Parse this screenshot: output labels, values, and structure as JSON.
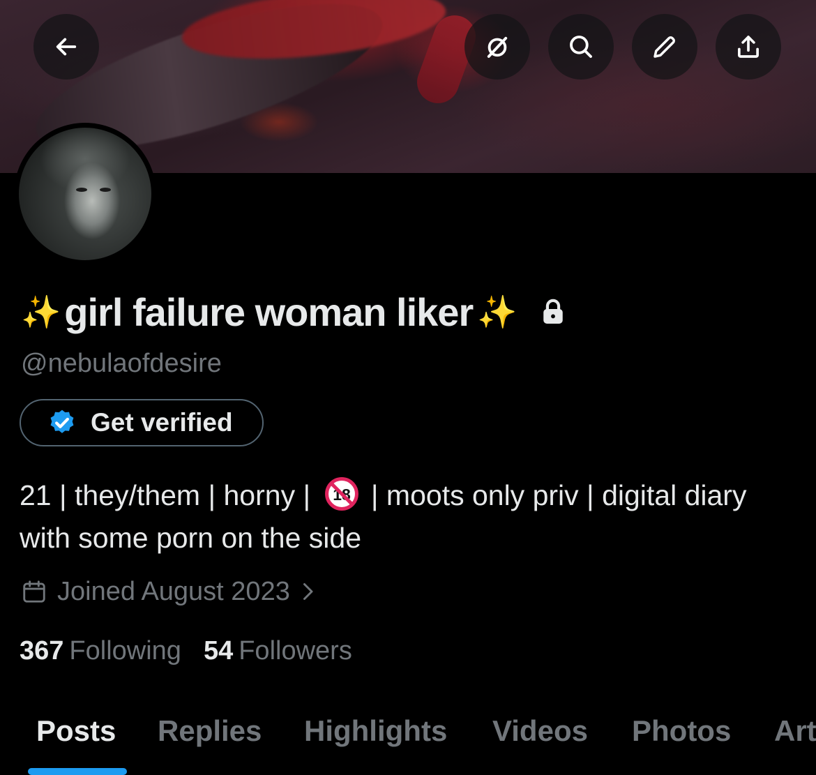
{
  "header": {
    "back_icon": "arrow-left-icon",
    "buttons": [
      {
        "icon": "grok-icon"
      },
      {
        "icon": "search-icon"
      },
      {
        "icon": "edit-pencil-icon"
      },
      {
        "icon": "share-upload-icon"
      }
    ]
  },
  "profile": {
    "display_name": "girl failure woman liker",
    "name_prefix_emoji": "✨",
    "name_suffix_emoji": "✨",
    "protected_icon": "lock-icon",
    "handle": "@nebulaofdesire",
    "get_verified_label": "Get verified",
    "bio_part1": "21 | they/them | horny | ",
    "bio_badge": "18",
    "bio_part2": " | moots only priv | digital diary with some porn on the side",
    "joined_text": "Joined August 2023",
    "following_count": "367",
    "following_label": "Following",
    "followers_count": "54",
    "followers_label": "Followers"
  },
  "tabs": [
    {
      "label": "Posts",
      "active": true
    },
    {
      "label": "Replies"
    },
    {
      "label": "Highlights"
    },
    {
      "label": "Videos"
    },
    {
      "label": "Photos"
    },
    {
      "label": "Articles"
    }
  ],
  "colors": {
    "accent": "#1d9bf0",
    "background": "#000000",
    "text_primary": "#e7e9ea",
    "text_secondary": "#71767b",
    "verified_badge": "#1d9bf0",
    "sparkle": "#f5c542",
    "age_badge_red": "#e0245e"
  }
}
